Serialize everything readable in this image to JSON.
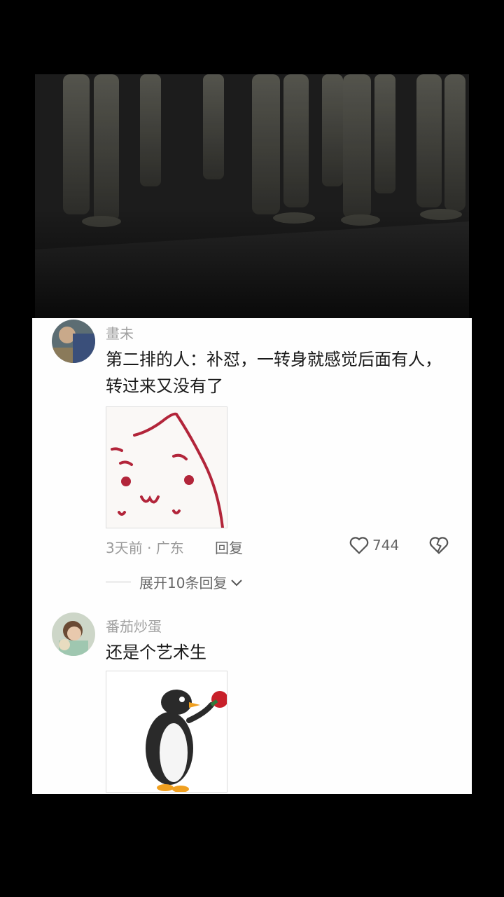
{
  "comments": [
    {
      "username": "畫未",
      "text": "第二排的人：补怼，一转身就感觉后面有人，转过来又没有了",
      "time_location": "3天前 · 广东",
      "reply_label": "回复",
      "like_count": "744",
      "expand_label": "展开10条回复",
      "sticker_icon": "cat-face-sticker"
    },
    {
      "username": "番茄炒蛋",
      "text": "还是个艺术生",
      "sticker_icon": "penguin-flower-sticker"
    }
  ],
  "colors": {
    "card_bg": "#fefefe",
    "username": "#a0a0a0",
    "text": "#1a1a1a",
    "meta": "#9a9a9a",
    "sticker_line": "#b2253a"
  }
}
